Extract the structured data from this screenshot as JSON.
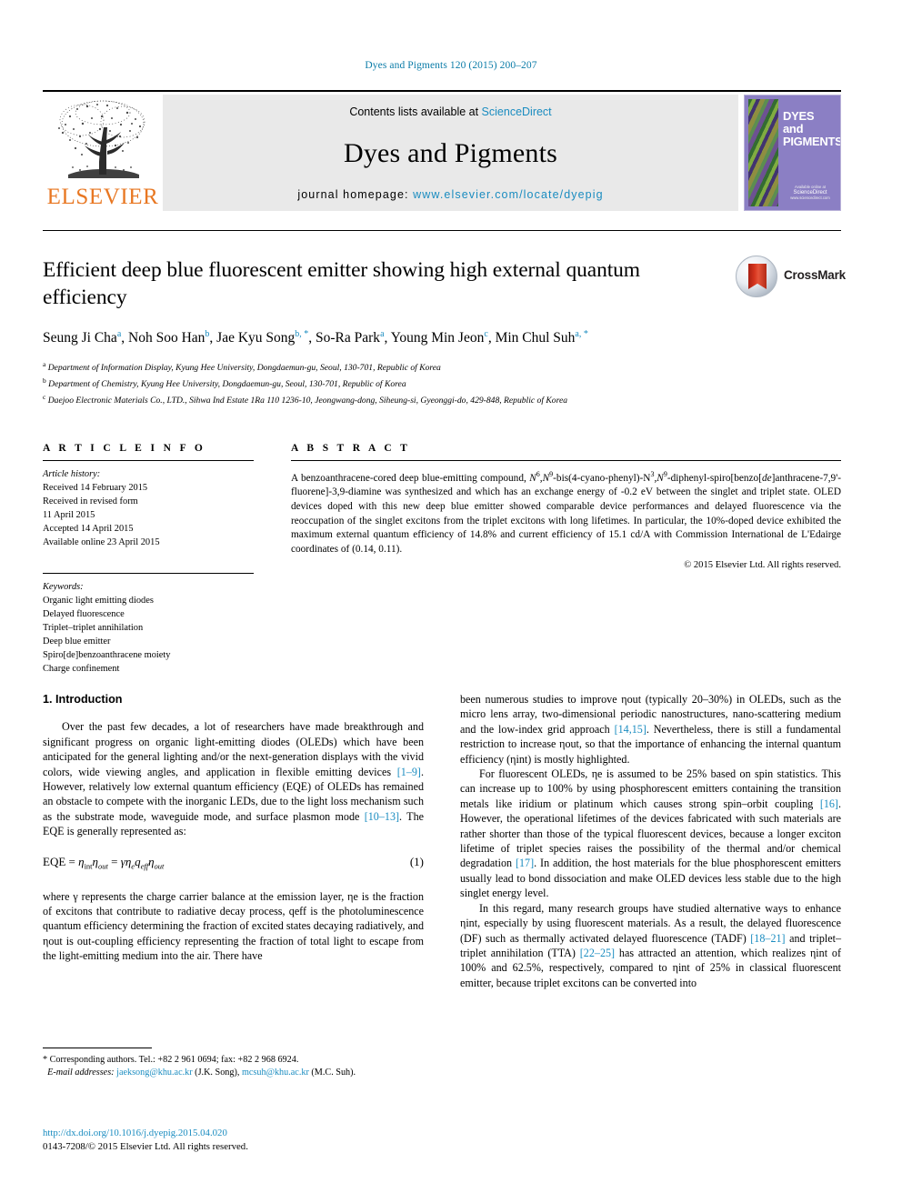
{
  "running_head": "Dyes and Pigments 120 (2015) 200–207",
  "masthead": {
    "publisher_name": "ELSEVIER",
    "contents_prefix": "Contents lists available at ",
    "contents_link": "ScienceDirect",
    "journal_title": "Dyes and Pigments",
    "homepage_prefix": "journal homepage: ",
    "homepage_url": "www.elsevier.com/locate/dyepig",
    "cover": {
      "title_line1": "DYES",
      "title_line2": "and",
      "title_line3": "PIGMENTS",
      "footer_label": "Available online at",
      "footer_mark": "ScienceDirect",
      "footer_sub": "www.sciencedirect.com"
    }
  },
  "article": {
    "title": "Efficient deep blue fluorescent emitter showing high external quantum efficiency",
    "crossmark_label": "CrossMark",
    "authors": [
      {
        "name": "Seung Ji Cha",
        "marks": "a",
        "sep": ", "
      },
      {
        "name": "Noh Soo Han",
        "marks": "b",
        "sep": ", "
      },
      {
        "name": "Jae Kyu Song",
        "marks": "b, *",
        "sep": ", "
      },
      {
        "name": "So-Ra Park",
        "marks": "a",
        "sep": ", "
      },
      {
        "name": "Young Min Jeon",
        "marks": "c",
        "sep": ", "
      },
      {
        "name": "Min Chul Suh",
        "marks": "a, *",
        "sep": ""
      }
    ],
    "affiliations": [
      {
        "mark": "a",
        "text": "Department of Information Display, Kyung Hee University, Dongdaemun-gu, Seoul, 130-701, Republic of Korea"
      },
      {
        "mark": "b",
        "text": "Department of Chemistry, Kyung Hee University, Dongdaemun-gu, Seoul, 130-701, Republic of Korea"
      },
      {
        "mark": "c",
        "text": "Daejoo Electronic Materials Co., LTD., Sihwa Ind Estate 1Ra 110 1236-10, Jeongwang-dong, Siheung-si, Gyeonggi-do, 429-848, Republic of Korea"
      }
    ]
  },
  "article_info": {
    "heading": "A R T I C L E  I N F O",
    "history_label": "Article history:",
    "history": [
      "Received 14 February 2015",
      "Received in revised form",
      "11 April 2015",
      "Accepted 14 April 2015",
      "Available online 23 April 2015"
    ],
    "keywords_label": "Keywords:",
    "keywords": [
      "Organic light emitting diodes",
      "Delayed fluorescence",
      "Triplet–triplet annihilation",
      "Deep blue emitter",
      "Spiro[de]benzoanthracene moiety",
      "Charge confinement"
    ]
  },
  "abstract": {
    "heading": "A B S T R A C T",
    "text_part1": "A benzoanthracene-cored deep blue-emitting compound, ",
    "formula_1": "N",
    "formula_1_sup": "6",
    "formula_2": ",N",
    "formula_2_sup": "9",
    "formula_3": "-bis(4-cyano-phenyl)-N",
    "formula_3_sup": "3",
    "formula_4": ",N",
    "formula_4_sup": "9",
    "formula_5": "-diphenyl-spiro[benzo[",
    "formula_italic": "de",
    "formula_6": "]anthracene-7,9'-fluorene]-3,9-diamine",
    "text_part2": " was synthesized and which has an exchange energy of -0.2 eV between the singlet and triplet state. OLED devices doped with this new deep blue emitter showed comparable device performances and delayed fluorescence via the reoccupation of the singlet excitons from the triplet excitons with long lifetimes. In particular, the 10%-doped device exhibited the maximum external quantum efficiency of 14.8% and current efficiency of 15.1 cd/A with Commission International de L'Edairge coordinates of (0.14, 0.11).",
    "copyright": "© 2015 Elsevier Ltd. All rights reserved."
  },
  "body": {
    "section_title": "1. Introduction",
    "left_col": {
      "para1_a": "Over the past few decades, a lot of researchers have made breakthrough and significant progress on organic light-emitting diodes (OLEDs) which have been anticipated for the general lighting and/or the next-generation displays with the vivid colors, wide viewing angles, and application in flexible emitting devices ",
      "ref1": "[1–9]",
      "para1_b": ". However, relatively low external quantum efficiency (EQE) of OLEDs has remained an obstacle to compete with the inorganic LEDs, due to the light loss mechanism such as the substrate mode, waveguide mode, and surface plasmon mode ",
      "ref2": "[10–13]",
      "para1_c": ". The EQE is generally represented as:",
      "equation": "EQE = ηintηout = γηeqeffηout",
      "equation_number": "(1)",
      "para2": "where γ represents the charge carrier balance at the emission layer, ηe is the fraction of excitons that contribute to radiative decay process, qeff is the photoluminescence quantum efficiency determining the fraction of excited states decaying radiatively, and ηout is out-coupling efficiency representing the fraction of total light to escape from the light-emitting medium into the air. There have"
    },
    "right_col": {
      "para1_a": "been numerous studies to improve ηout (typically 20–30%) in OLEDs, such as the micro lens array, two-dimensional periodic nanostructures, nano-scattering medium and the low-index grid approach ",
      "ref1": "[14,15]",
      "para1_b": ". Nevertheless, there is still a fundamental restriction to increase ηout, so that the importance of enhancing the internal quantum efficiency (ηint) is mostly highlighted.",
      "para2_a": "For fluorescent OLEDs, ηe is assumed to be 25% based on spin statistics. This can increase up to 100% by using phosphorescent emitters containing the transition metals like iridium or platinum which causes strong spin–orbit coupling ",
      "ref2": "[16]",
      "para2_b": ". However, the operational lifetimes of the devices fabricated with such materials are rather shorter than those of the typical fluorescent devices, because a longer exciton lifetime of triplet species raises the possibility of the thermal and/or chemical degradation ",
      "ref3": "[17]",
      "para2_c": ". In addition, the host materials for the blue phosphorescent emitters usually lead to bond dissociation and make OLED devices less stable due to the high singlet energy level.",
      "para3_a": "In this regard, many research groups have studied alternative ways to enhance ηint, especially by using fluorescent materials. As a result, the delayed fluorescence (DF) such as thermally activated delayed fluorescence (TADF) ",
      "ref4": "[18–21]",
      "para3_b": " and triplet–triplet annihilation (TTA) ",
      "ref5": "[22–25]",
      "para3_c": " has attracted an attention, which realizes ηint of 100% and 62.5%, respectively, compared to ηint of 25% in classical fluorescent emitter, because triplet excitons can be converted into"
    }
  },
  "footnotes": {
    "corresponding": "* Corresponding authors. Tel.: +82 2 961 0694; fax: +82 2 968 6924.",
    "email_label": "E-mail addresses:",
    "email1": "jaeksong@khu.ac.kr",
    "email1_owner": " (J.K. Song), ",
    "email2": "mcsuh@khu.ac.kr",
    "email2_owner": " (M.C. Suh).",
    "doi": "http://dx.doi.org/10.1016/j.dyepig.2015.04.020",
    "issn": "0143-7208/© 2015 Elsevier Ltd. All rights reserved."
  },
  "colors": {
    "link_blue": "#1a8cc0",
    "running_head_blue": "#0b7ca8",
    "elsevier_orange": "#E87722",
    "band_gray": "#e9e9e9",
    "cover_purple": "#8b7fc4",
    "crossmark_red": "#d7361f"
  }
}
